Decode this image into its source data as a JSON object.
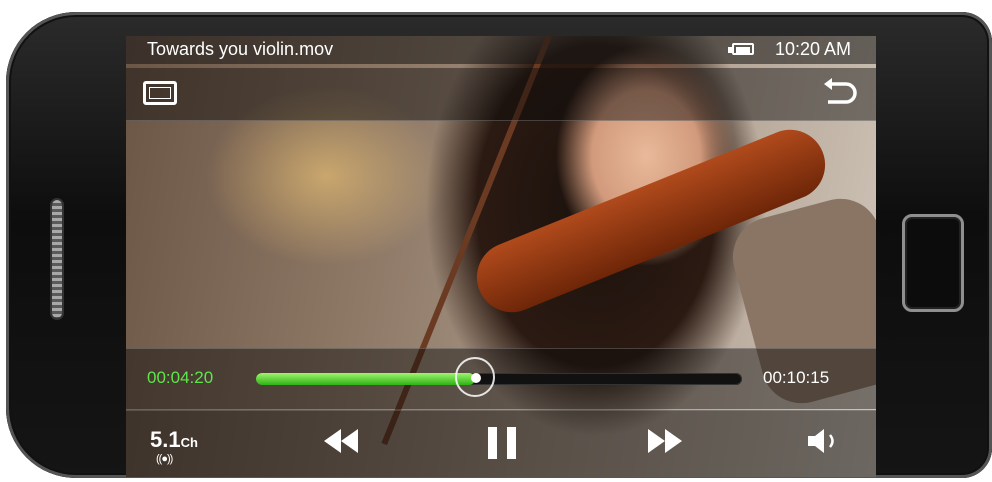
{
  "status_bar": {
    "file_name": "Towards you violin.mov",
    "time": "10:20 AM",
    "battery_icon": "battery-icon"
  },
  "top_bar": {
    "screen_mode_icon": "screen-mode-icon",
    "back_icon": "back-icon"
  },
  "playback": {
    "current_time": "00:04:20",
    "total_time": "00:10:15",
    "progress": 0.45,
    "progress_color": "#3dcc1f"
  },
  "controls": {
    "audio_channel_main": "5.1",
    "audio_channel_suffix": "Ch",
    "audio_channel_waves": "((●))",
    "rewind_icon": "rewind-icon",
    "pause_icon": "pause-icon",
    "fast_forward_icon": "fast-forward-icon",
    "volume_icon": "volume-icon"
  }
}
